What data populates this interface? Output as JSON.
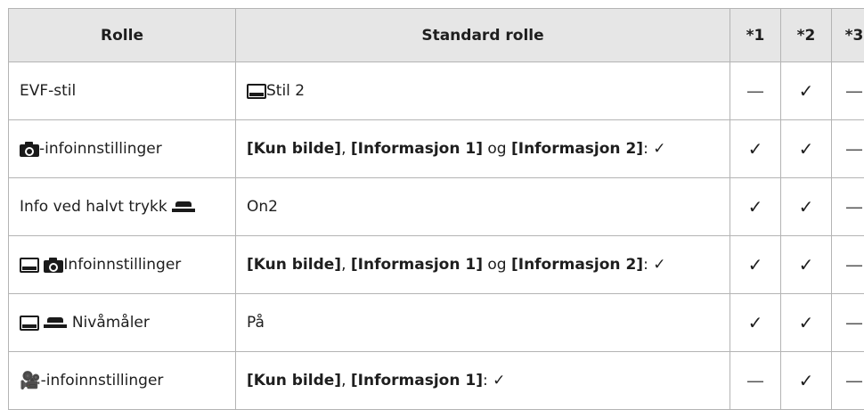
{
  "headers": {
    "rolle": "Rolle",
    "standard": "Standard rolle",
    "n1": "*1",
    "n2": "*2",
    "n3": "*3"
  },
  "rows": [
    {
      "rolle": "EVF-stil",
      "standard": "Stil 2",
      "c1": "—",
      "c2": "✓",
      "c3": "—"
    },
    {
      "rolle": "-infoinnstillinger",
      "std_a": "[Kun bilde]",
      "std_sep1": ", ",
      "std_b": "[Informasjon 1]",
      "std_og": " og ",
      "std_c": "[Informasjon 2]",
      "std_colon": ": ",
      "std_check": "✓",
      "c1": "✓",
      "c2": "✓",
      "c3": "—"
    },
    {
      "rolle": "Info ved halvt trykk",
      "standard": "On2",
      "c1": "✓",
      "c2": "✓",
      "c3": "—"
    },
    {
      "rolle": "Infoinnstillinger",
      "std_a": "[Kun bilde]",
      "std_sep1": ", ",
      "std_b": "[Informasjon 1]",
      "std_og": " og ",
      "std_c": "[Informasjon 2]",
      "std_colon": ": ",
      "std_check": "✓",
      "c1": "✓",
      "c2": "✓",
      "c3": "—"
    },
    {
      "rolle": "Nivåmåler",
      "standard": "På",
      "c1": "✓",
      "c2": "✓",
      "c3": "—"
    },
    {
      "rolle": "-infoinnstillinger",
      "std_a": "[Kun bilde]",
      "std_sep1": ", ",
      "std_b": "[Informasjon 1]",
      "std_colon": ": ",
      "std_check": "✓",
      "c1": "—",
      "c2": "✓",
      "c3": "—"
    }
  ],
  "icons": {
    "camera": "camera-icon",
    "monitor": "monitor-icon",
    "half_press": "half-press-icon",
    "video": "video-icon",
    "video_glyph": "🎥"
  }
}
